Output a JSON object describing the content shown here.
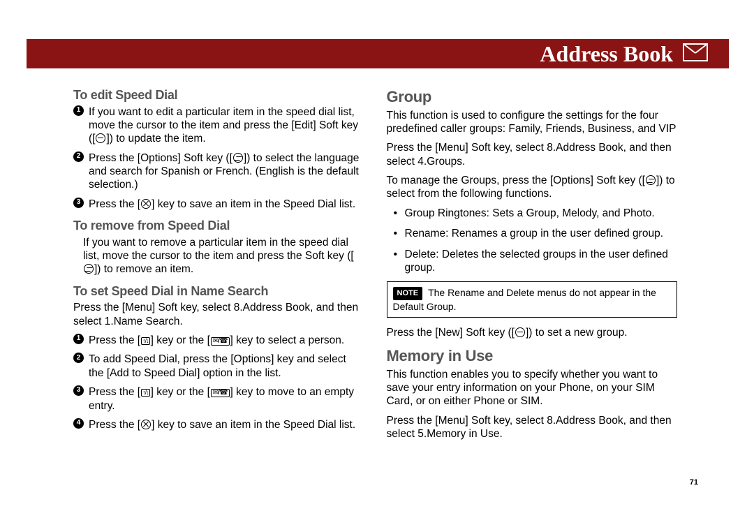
{
  "header": {
    "title": "Address Book",
    "icon": "envelope-outline"
  },
  "page_number": "71",
  "left": {
    "sec1": {
      "heading": "To edit Speed Dial",
      "items": {
        "i1": "If you want to edit a particular item in the speed dial list, move the cursor to the item and press the [Edit] Soft key ([↘]) to update the item.",
        "i2": "Press the [Options] Soft key ([↗]) to select the language and search for Spanish or French. (English is the default selection.)",
        "i3": "Press the [✕] key to save an item in the Speed Dial list."
      }
    },
    "sec2": {
      "heading": "To remove from Speed Dial",
      "body": "If you want to remove a particular item in the speed dial list, move the cursor to the item and press the Soft key ([↗]) to remove an item."
    },
    "sec3": {
      "heading": "To set Speed Dial in Name Search",
      "intro": "Press the [Menu] Soft key, select 8.Address Book, and then select 1.Name Search.",
      "items": {
        "i1": "Press the [↑/↓] key or the [✉/☎] key to select a person.",
        "i2": "To add Speed Dial, press the [Options] key and select the [Add to Speed Dial] option in the list.",
        "i3": "Press the [↑/↓] key or the [✉/☎] key to move to an empty entry.",
        "i4": "Press the [✕] key to save an item in the Speed Dial list."
      }
    }
  },
  "right": {
    "group": {
      "heading": "Group",
      "p1": "This function is used to configure the settings for the four predefined caller groups: Family, Friends, Business, and VIP",
      "p2": "Press the [Menu] Soft key, select 8.Address Book, and then select 4.Groups.",
      "p3": "To manage the Groups, press the [Options] Soft key ([↗]) to select from the following functions.",
      "bullets": {
        "b1": "Group Ringtones: Sets a Group, Melody, and Photo.",
        "b2": "Rename: Renames a group in the user defined group.",
        "b3": "Delete: Deletes the selected groups in the user defined group."
      },
      "note_label": "NOTE",
      "note": "The Rename and Delete menus do not appear in the Default Group.",
      "p4": "Press the [New] Soft key ([↘]) to set a new group."
    },
    "memory": {
      "heading": "Memory in Use",
      "p1": "This function enables you to specify whether you want to save your entry information on your Phone, on your SIM Card, or on either Phone or SIM.",
      "p2": "Press the [Menu] Soft key, select 8.Address Book, and then select 5.Memory in Use."
    }
  }
}
